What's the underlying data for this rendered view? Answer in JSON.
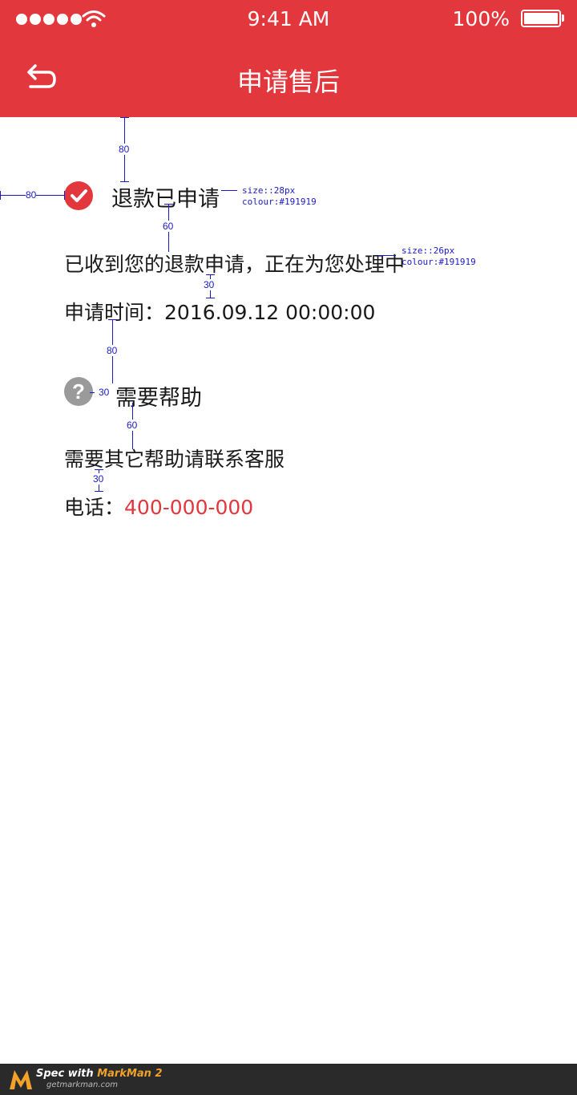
{
  "status_bar": {
    "time": "9:41 AM",
    "battery": "100%"
  },
  "header": {
    "title": "申请售后"
  },
  "refund": {
    "status": "退款已申请",
    "message": "已收到您的退款申请，正在为您处理中",
    "time_label": "申请时间：",
    "time_value": "2016.09.12  00:00:00"
  },
  "help": {
    "title": "需要帮助",
    "message": "需要其它帮助请联系客服",
    "phone_label": "电话：",
    "phone_value": "400-000-000"
  },
  "annotations": {
    "gap_80": "80",
    "gap_60": "60",
    "gap_30": "30",
    "size_28": "size::28px",
    "size_26": "size::26px",
    "colour": "colour:#191919"
  },
  "footer": {
    "brand_prefix": "Spec with ",
    "brand_name": "MarkMan 2",
    "url": "getmarkman.com"
  },
  "colors": {
    "brand_red": "#e2383d",
    "text": "#191919",
    "annotation": "#1a1ac8"
  },
  "icons": [
    "wifi-icon",
    "back-icon",
    "check-circle-icon",
    "help-circle-icon"
  ]
}
